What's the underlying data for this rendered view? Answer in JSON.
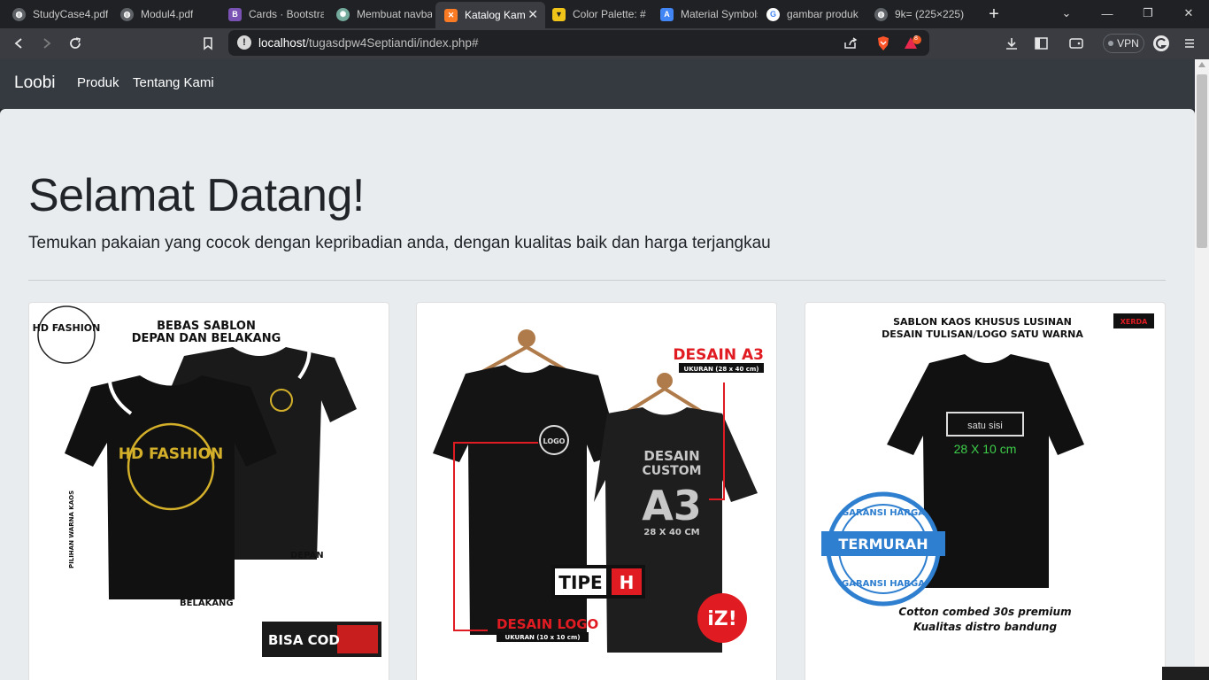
{
  "browser": {
    "tabs": [
      {
        "title": "StudyCase4.pdf",
        "icon": "globe-icon",
        "color": "#9aa0a6"
      },
      {
        "title": "Modul4.pdf",
        "icon": "globe-icon",
        "color": "#9aa0a6"
      },
      {
        "title": "Cards · Bootstrap",
        "icon": "bootstrap-icon",
        "color": "#7952b3"
      },
      {
        "title": "Membuat navbar",
        "icon": "chatgpt-icon",
        "color": "#74aa9c"
      },
      {
        "title": "Katalog Kami",
        "icon": "xampp-icon",
        "color": "#fb7a24",
        "active": true
      },
      {
        "title": "Color Palette: #",
        "icon": "coolors-icon",
        "color": "#f0c419"
      },
      {
        "title": "Material Symbols",
        "icon": "google-fonts-icon",
        "color": "#4285f4"
      },
      {
        "title": "gambar produk",
        "icon": "google-icon",
        "color": "#ffffff"
      },
      {
        "title": "9k= (225×225)",
        "icon": "globe-icon",
        "color": "#9aa0a6"
      }
    ],
    "close_glyph": "✕",
    "new_tab_glyph": "+",
    "url_host": "localhost",
    "url_path": "/tugasdpw4Septiandi/index.php#",
    "vpn_label": "VPN",
    "brave_badge_count": "8"
  },
  "navbar": {
    "brand": "Loobi",
    "links": [
      "Produk",
      "Tentang Kami"
    ]
  },
  "hero": {
    "title": "Selamat Datang!",
    "lead": "Temukan pakaian yang cocok dengan kepribadian anda, dengan kualitas baik dan harga terjangkau"
  },
  "products": [
    {
      "badge": "HD FASHION",
      "headline_1": "BEBAS SABLON",
      "headline_2": "DEPAN DAN BELAKANG",
      "print_front": "HD FASHION",
      "label_front": "DEPAN",
      "label_back": "BELAKANG",
      "side_note": "PILIHAN WARNA KAOS",
      "cod": "BISA COD"
    },
    {
      "top_label": "DESAIN A3",
      "top_size": "UKURAN (28 x 40 cm)",
      "shirt_text_1": "DESAIN",
      "shirt_text_2": "CUSTOM",
      "shirt_text_3": "A3",
      "shirt_size": "28 X 40 CM",
      "logo_text": "LOGO",
      "tipe": "TIPE",
      "tipe_letter": "H",
      "bottom_label": "DESAIN LOGO",
      "bottom_size": "UKURAN (10 x 10 cm)",
      "brand_mark": "iZ!"
    },
    {
      "headline_1": "SABLON KAOS KHUSUS LUSINAN",
      "headline_2": "DESAIN TULISAN/LOGO SATU WARNA",
      "tag": "XERDA",
      "box_text": "satu sisi",
      "size_text": "28 X 10 cm",
      "stamp_top": "GARANSI HARGA",
      "stamp_main": "TERMURAH",
      "stamp_bottom": "GARANSI HARGA",
      "caption_1": "Cotton combed 30s premium",
      "caption_2": "Kualitas distro bandung"
    }
  ],
  "colors": {
    "navbar": "#343a40",
    "jumbotron": "#e9ecef",
    "accent_red": "#e11b22",
    "accent_green": "#3ecf4a",
    "accent_blue": "#2f7fd0"
  }
}
